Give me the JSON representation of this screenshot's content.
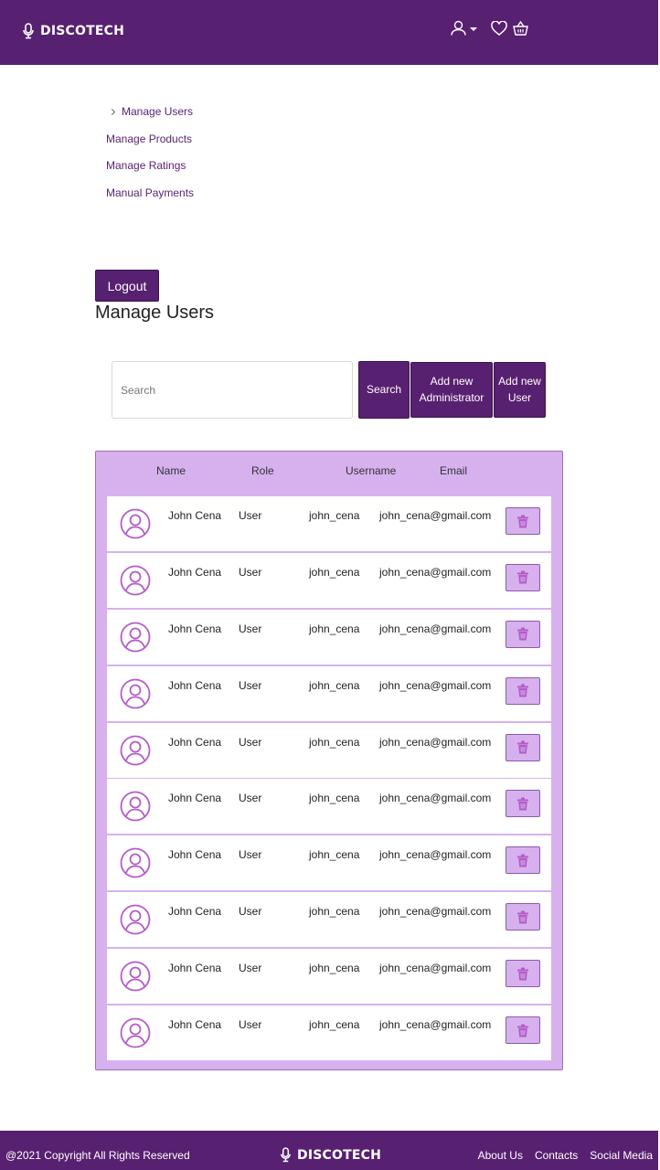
{
  "header": {
    "brand": "DISCOTECH",
    "icons": [
      "microphone-icon",
      "user-icon",
      "heart-icon",
      "basket-icon"
    ]
  },
  "menu": {
    "items": [
      {
        "label": "Manage Users",
        "active": true
      },
      {
        "label": "Manage Products"
      },
      {
        "label": "Manage Ratings"
      },
      {
        "label": "Manual Payments"
      }
    ]
  },
  "logout_label": "Logout",
  "page_title": "Manage Users",
  "search": {
    "placeholder": "Search",
    "value": "",
    "button_label": "Search",
    "add_admin_label": "Add new Administrator",
    "add_user_label": "Add new User"
  },
  "table": {
    "headers": {
      "name": "Name",
      "role": "Role",
      "username": "Username",
      "email": "Email"
    },
    "rows": [
      {
        "name": "John Cena",
        "role": "User",
        "username": "john_cena",
        "email": "john_cena@gmail.com"
      },
      {
        "name": "John Cena",
        "role": "User",
        "username": "john_cena",
        "email": "john_cena@gmail.com"
      },
      {
        "name": "John Cena",
        "role": "User",
        "username": "john_cena",
        "email": "john_cena@gmail.com"
      },
      {
        "name": "John Cena",
        "role": "User",
        "username": "john_cena",
        "email": "john_cena@gmail.com"
      },
      {
        "name": "John Cena",
        "role": "User",
        "username": "john_cena",
        "email": "john_cena@gmail.com"
      },
      {
        "name": "John Cena",
        "role": "User",
        "username": "john_cena",
        "email": "john_cena@gmail.com"
      },
      {
        "name": "John Cena",
        "role": "User",
        "username": "john_cena",
        "email": "john_cena@gmail.com"
      },
      {
        "name": "John Cena",
        "role": "User",
        "username": "john_cena",
        "email": "john_cena@gmail.com"
      },
      {
        "name": "John Cena",
        "role": "User",
        "username": "john_cena",
        "email": "john_cena@gmail.com"
      },
      {
        "name": "John Cena",
        "role": "User",
        "username": "john_cena",
        "email": "john_cena@gmail.com"
      }
    ]
  },
  "footer": {
    "copyright": "@2021 Copyright All Rights Reserved",
    "brand": "DISCOTECH",
    "links": [
      "About Us",
      "Contacts",
      "Social Media"
    ]
  },
  "colors": {
    "primary": "#582070",
    "table_bg": "#d6b1ee",
    "accent": "#b45cc8",
    "link": "#5a2274"
  }
}
